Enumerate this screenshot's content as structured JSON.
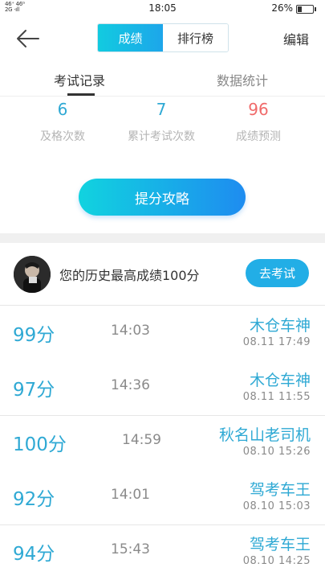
{
  "status_bar": {
    "signal_top": "46⁺ 46ᴳ",
    "signal_bottom": "2G ·ıll",
    "time": "18:05",
    "battery_text": "26%",
    "battery_level": 0.26
  },
  "nav": {
    "tabs": [
      {
        "label": "成绩",
        "active": true
      },
      {
        "label": "排行榜",
        "active": false
      }
    ],
    "edit_label": "编辑",
    "back_icon": "arrow-left-icon"
  },
  "sub_tabs": [
    {
      "label": "考试记录",
      "active": true
    },
    {
      "label": "数据统计",
      "active": false
    }
  ],
  "stats": [
    {
      "value": "6",
      "label": "及格次数",
      "color": "#2fa9d4"
    },
    {
      "value": "7",
      "label": "累计考试次数",
      "color": "#2fa9d4"
    },
    {
      "value": "96",
      "label": "成绩预测",
      "color": "#f06a6a"
    }
  ],
  "improve_button_label": "提分攻略",
  "best": {
    "text": "您的历史最高成绩100分",
    "exam_button_label": "去考试"
  },
  "records": [
    {
      "score": "99分",
      "time": "14:03",
      "title": "木仓车神",
      "date": "08.11  17:49"
    },
    {
      "score": "97分",
      "time": "14:36",
      "title": "木仓车神",
      "date": "08.11  11:55"
    },
    {
      "score": "100分",
      "time": "14:59",
      "title": "秋名山老司机",
      "date": "08.10  15:26"
    },
    {
      "score": "92分",
      "time": "14:01",
      "title": "驾考车王",
      "date": "08.10  15:03"
    },
    {
      "score": "94分",
      "time": "15:43",
      "title": "驾考车王",
      "date": "08.10  14:25"
    }
  ]
}
